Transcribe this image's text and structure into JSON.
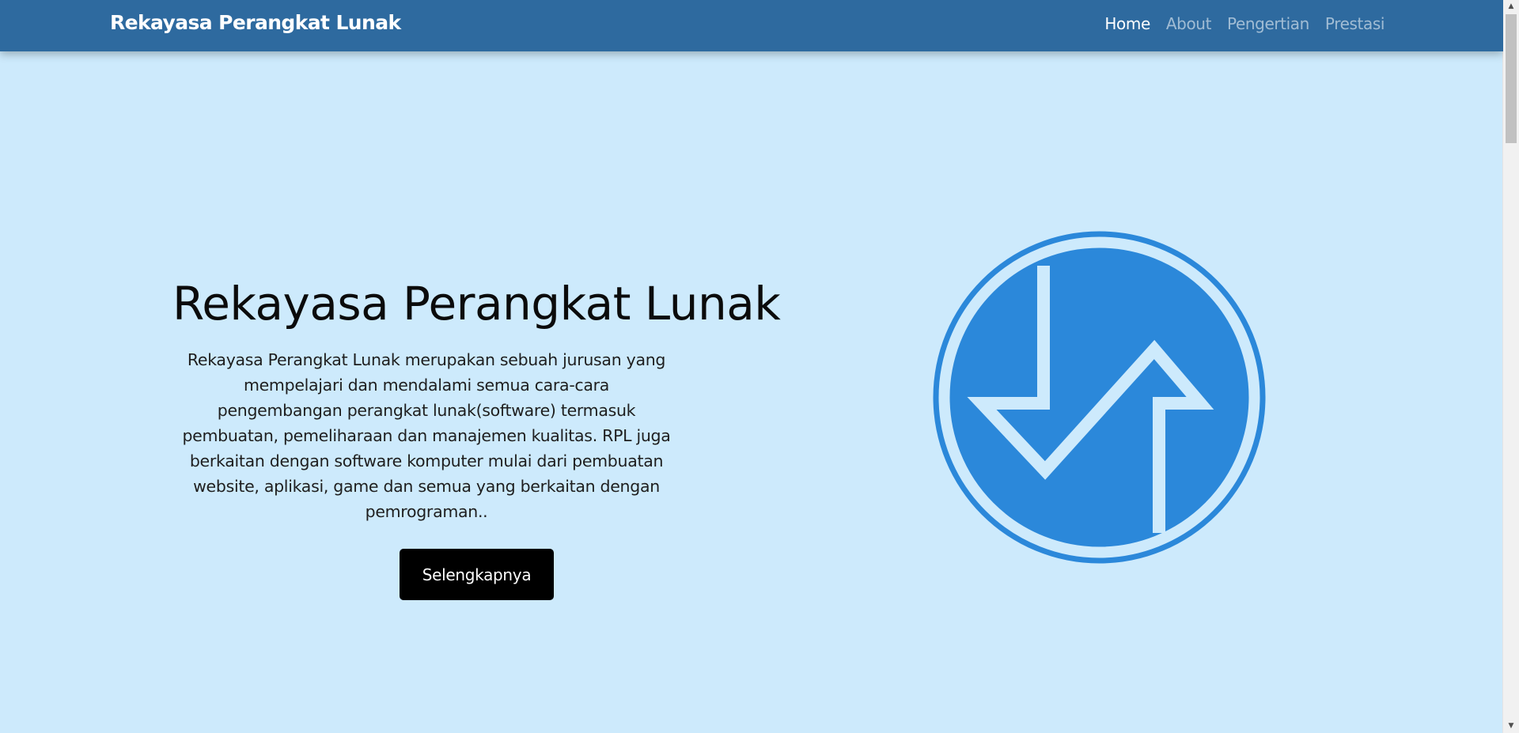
{
  "navbar": {
    "brand": "Rekayasa Perangkat Lunak",
    "links": [
      {
        "label": "Home",
        "active": true
      },
      {
        "label": "About",
        "active": false
      },
      {
        "label": "Pengertian",
        "active": false
      },
      {
        "label": "Prestasi",
        "active": false
      }
    ]
  },
  "hero": {
    "title": "Rekayasa Perangkat Lunak",
    "description": "Rekayasa Perangkat Lunak merupakan sebuah jurusan yang mempelajari dan mendalami semua cara-cara pengembangan perangkat lunak(software) termasuk pembuatan, pemeliharaan dan manajemen kualitas. RPL juga berkaitan dengan software komputer mulai dari pembuatan website, aplikasi, game dan semua yang berkaitan dengan pemrograman..",
    "button_label": "Selengkapnya",
    "logo_icon": "rpl-logo-icon"
  },
  "colors": {
    "navbar": "#2e6a9f",
    "background": "#cdeafc",
    "logo_blue": "#2b88da",
    "button": "#000000"
  },
  "scrollbar": {
    "up_arrow": "▲",
    "down_arrow": "▼"
  }
}
